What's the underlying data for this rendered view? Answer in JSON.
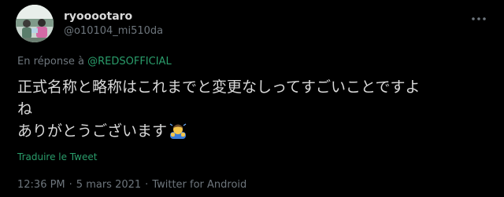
{
  "author": {
    "display_name": "ryooootaro",
    "handle": "@o10104_mi510da"
  },
  "reply": {
    "prefix": "En réponse à",
    "mention": "@REDSOFFICIAL"
  },
  "tweet": {
    "lines": [
      "正式名称と略称はこれまでと変更なしってすごいことですよ",
      "ね",
      "ありがとうございます"
    ],
    "emoji": "person-bowing-emoji"
  },
  "translate_label": "Traduire le Tweet",
  "meta": {
    "time": "12:36 PM",
    "separator": "·",
    "date": "5 mars 2021",
    "source": "Twitter for Android"
  },
  "colors": {
    "background": "#000000",
    "text": "#d9d9d9",
    "muted": "#6e767d",
    "accent": "#2a9d6b"
  }
}
